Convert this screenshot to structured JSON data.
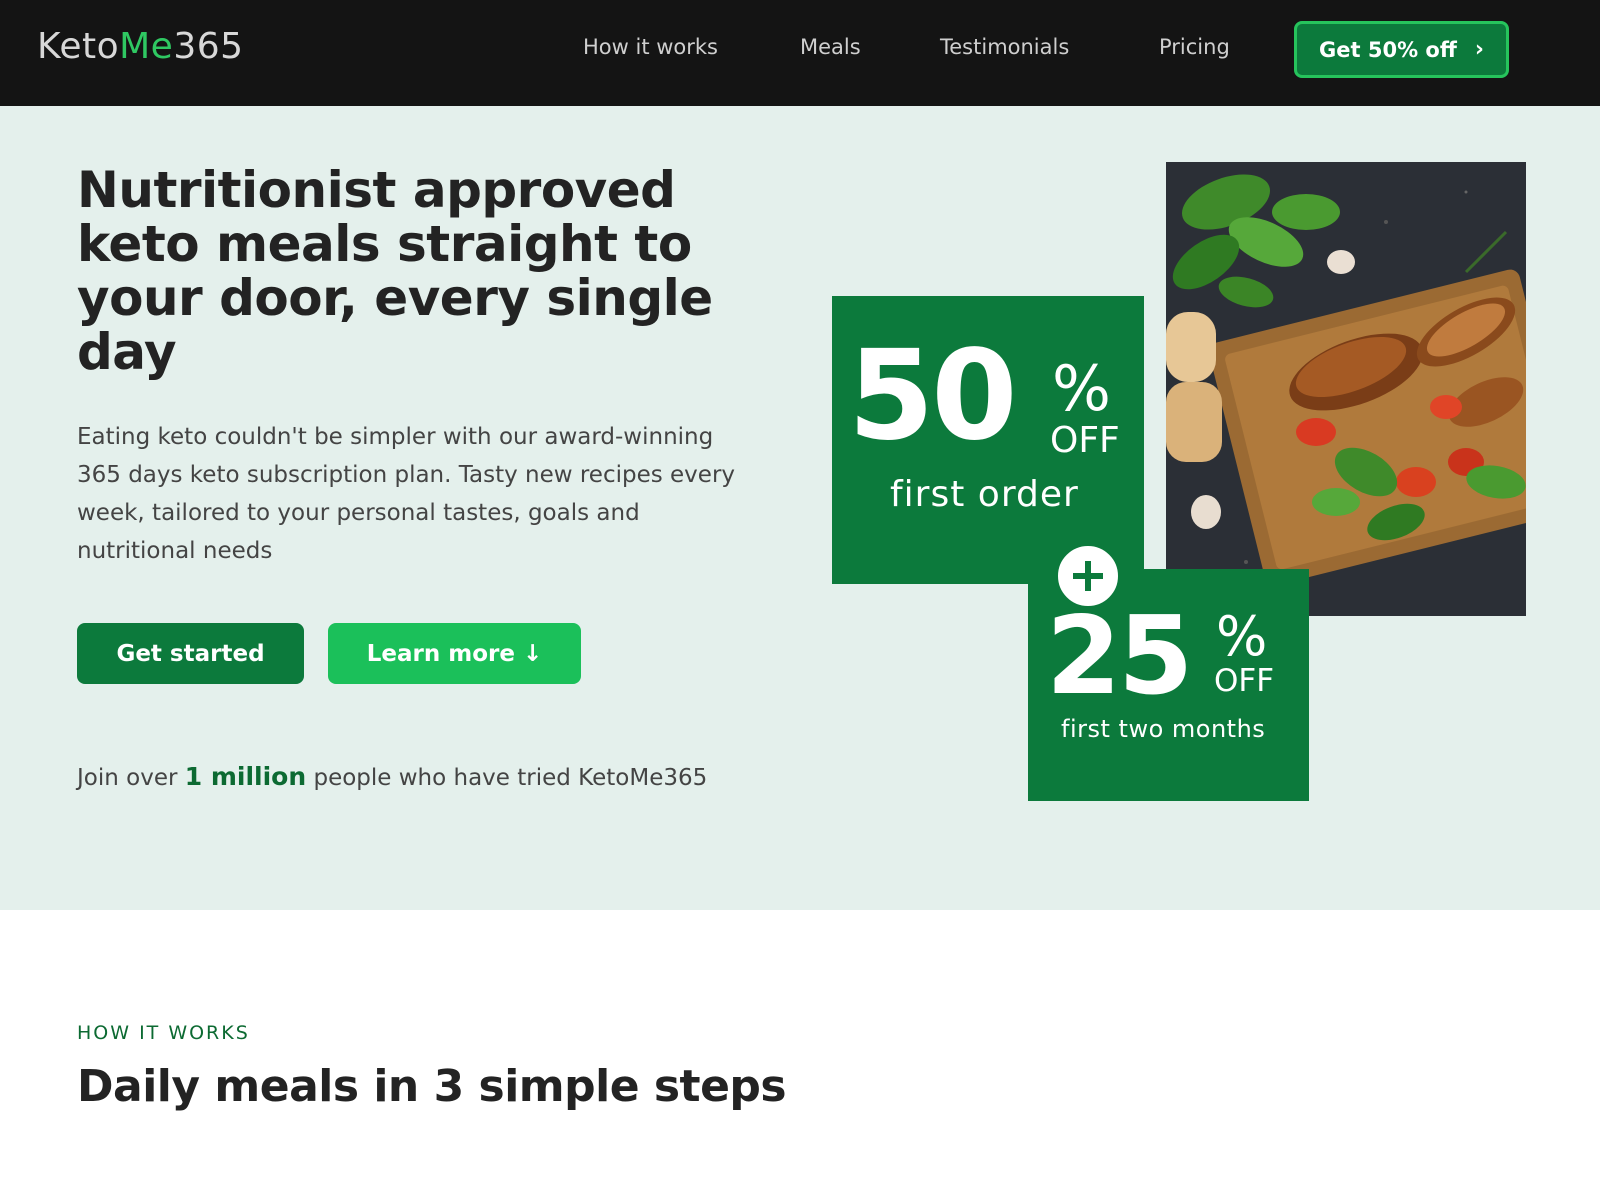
{
  "nav": {
    "logo_part1": "Keto",
    "logo_part2": "Me",
    "logo_part3": "365",
    "links": [
      "How it works",
      "Meals",
      "Testimonials",
      "Pricing"
    ],
    "cta_label": "Get 50% off",
    "cta_icon": "chevron-right-icon"
  },
  "hero": {
    "headline": "Nutritionist approved keto meals straight to your door, every single day",
    "description": "Eating keto couldn't be simpler with our award-winning 365 days keto subscription plan. Tasty new recipes every week, tailored to your personal tastes, goals and nutritional needs",
    "primary_button": "Get started",
    "secondary_button": "Learn more ↓",
    "social_prefix": "Join over",
    "social_highlight": "1 million",
    "social_suffix": "people who have tried KetoMe365"
  },
  "promo": {
    "first_value": "50",
    "first_percent": "%",
    "first_off": "OFF",
    "first_caption": "first order",
    "second_value": "25",
    "second_percent": "%",
    "second_off": "OFF",
    "second_caption": "first two months",
    "plus_icon": "plus-icon"
  },
  "how_it_works": {
    "eyebrow": "HOW IT WORKS",
    "title": "Daily meals in 3 simple steps"
  },
  "colors": {
    "nav_bg": "#141414",
    "hero_bg": "#e4f0ec",
    "brand_dark_green": "#0c7a3c",
    "brand_light_green": "#1bc05a",
    "logo_accent": "#2fc862"
  }
}
